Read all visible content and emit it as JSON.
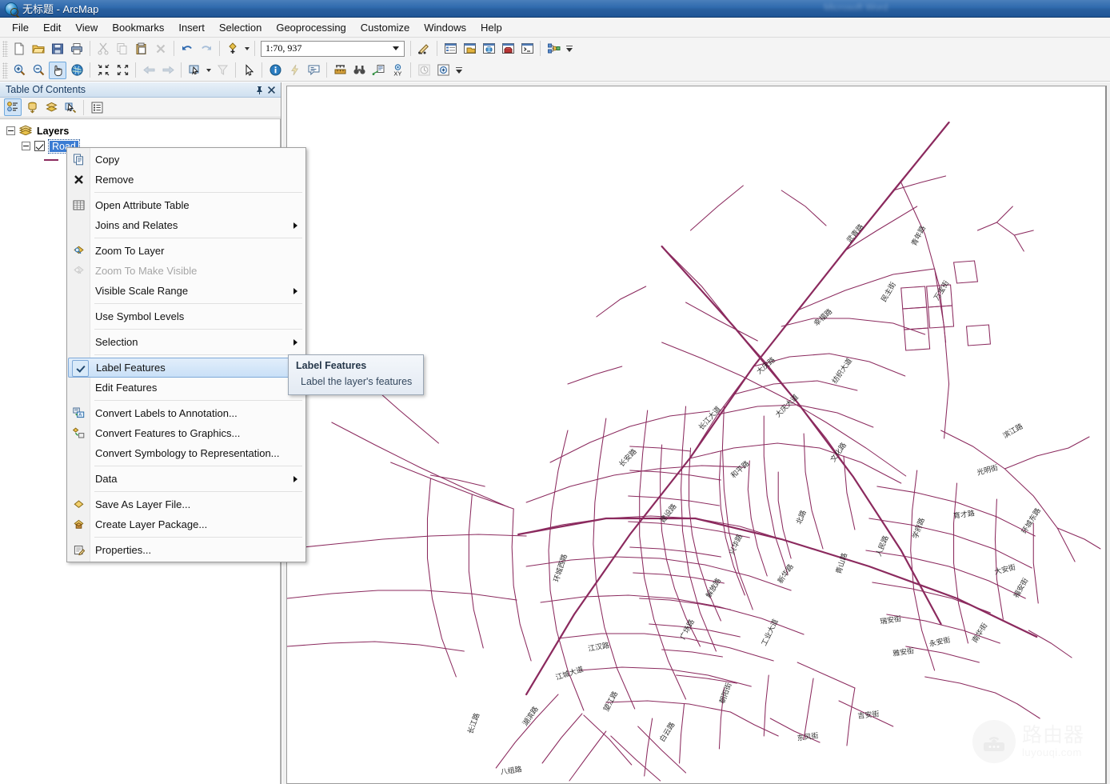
{
  "window": {
    "title": "无标题 - ArcMap",
    "ghost_title": "Microsoft Word"
  },
  "menubar": {
    "items": [
      {
        "label": "File"
      },
      {
        "label": "Edit"
      },
      {
        "label": "View"
      },
      {
        "label": "Bookmarks"
      },
      {
        "label": "Insert"
      },
      {
        "label": "Selection"
      },
      {
        "label": "Geoprocessing"
      },
      {
        "label": "Customize"
      },
      {
        "label": "Windows"
      },
      {
        "label": "Help"
      }
    ]
  },
  "toolbar_standard": {
    "scale_value": "1:70, 937",
    "buttons": [
      {
        "name": "new-map",
        "title": "New"
      },
      {
        "name": "open-map",
        "title": "Open"
      },
      {
        "name": "save-map",
        "title": "Save"
      },
      {
        "name": "print-map",
        "title": "Print"
      },
      {
        "name": "cut",
        "title": "Cut"
      },
      {
        "name": "copy",
        "title": "Copy"
      },
      {
        "name": "paste",
        "title": "Paste"
      },
      {
        "name": "delete",
        "title": "Delete"
      },
      {
        "name": "undo",
        "title": "Undo"
      },
      {
        "name": "redo",
        "title": "Redo"
      },
      {
        "name": "add-data",
        "title": "Add Data"
      },
      {
        "name": "editor-toolbar",
        "title": "Editor Toolbar"
      },
      {
        "name": "table-of-contents",
        "title": "Table Of Contents"
      },
      {
        "name": "catalog-window",
        "title": "Catalog"
      },
      {
        "name": "search-window",
        "title": "Search"
      },
      {
        "name": "arctoolbox-window",
        "title": "ArcToolbox"
      },
      {
        "name": "python-window",
        "title": "Python"
      },
      {
        "name": "model-builder",
        "title": "ModelBuilder"
      }
    ]
  },
  "toolbar_tools": {
    "buttons": [
      {
        "name": "zoom-in",
        "title": "Zoom In"
      },
      {
        "name": "zoom-out",
        "title": "Zoom Out"
      },
      {
        "name": "pan",
        "title": "Pan",
        "active": true
      },
      {
        "name": "full-extent",
        "title": "Full Extent"
      },
      {
        "name": "fixed-zoom-in",
        "title": "Fixed Zoom In"
      },
      {
        "name": "fixed-zoom-out",
        "title": "Fixed Zoom Out"
      },
      {
        "name": "go-back-extent",
        "title": "Go Back To Previous Extent"
      },
      {
        "name": "go-next-extent",
        "title": "Go To Next Extent"
      },
      {
        "name": "select-features",
        "title": "Select Features"
      },
      {
        "name": "clear-selection",
        "title": "Clear Selected Features"
      },
      {
        "name": "select-elements",
        "title": "Select Elements"
      },
      {
        "name": "identify",
        "title": "Identify"
      },
      {
        "name": "hyperlink",
        "title": "Hyperlink"
      },
      {
        "name": "html-popup",
        "title": "HTML Popup"
      },
      {
        "name": "measure",
        "title": "Measure"
      },
      {
        "name": "find",
        "title": "Find"
      },
      {
        "name": "find-route",
        "title": "Find Route"
      },
      {
        "name": "go-to-xy",
        "title": "Go To XY"
      },
      {
        "name": "time-slider",
        "title": "Time Slider"
      },
      {
        "name": "create-viewer-window",
        "title": "Create Viewer Window"
      }
    ]
  },
  "toc": {
    "title": "Table Of Contents",
    "pin_icon": "pin-icon",
    "close_icon": "close-icon",
    "toolbar_buttons": [
      {
        "name": "list-by-drawing-order",
        "active": true
      },
      {
        "name": "list-by-source",
        "active": false
      },
      {
        "name": "list-by-visibility",
        "active": false
      },
      {
        "name": "list-by-selection",
        "active": false
      },
      {
        "name": "options",
        "active": false
      }
    ],
    "tree": {
      "root_label": "Layers",
      "layer_label": "Road",
      "layer_checked": true,
      "layer_selected": true,
      "symbol_color": "#8b2a5e"
    }
  },
  "context_menu": {
    "items": [
      {
        "label": "Copy",
        "icon": "copy-icon",
        "type": "item"
      },
      {
        "label": "Remove",
        "icon": "remove-x-icon",
        "type": "item"
      },
      {
        "type": "separator"
      },
      {
        "label": "Open Attribute Table",
        "icon": "table-icon",
        "type": "item"
      },
      {
        "label": "Joins and Relates",
        "icon": "",
        "type": "submenu"
      },
      {
        "type": "separator"
      },
      {
        "label": "Zoom To Layer",
        "icon": "zoom-to-layer-icon",
        "type": "item"
      },
      {
        "label": "Zoom To Make Visible",
        "icon": "zoom-visible-icon",
        "type": "item",
        "disabled": true
      },
      {
        "label": "Visible Scale Range",
        "icon": "",
        "type": "submenu"
      },
      {
        "type": "separator"
      },
      {
        "label": "Use Symbol Levels",
        "icon": "",
        "type": "item"
      },
      {
        "type": "separator"
      },
      {
        "label": "Selection",
        "icon": "",
        "type": "submenu"
      },
      {
        "type": "separator"
      },
      {
        "label": "Label Features",
        "icon": "check-icon",
        "type": "item",
        "checked": true,
        "highlighted": true
      },
      {
        "label": "Edit Features",
        "icon": "",
        "type": "item"
      },
      {
        "type": "separator"
      },
      {
        "label": "Convert Labels to Annotation...",
        "icon": "labels-to-annotation-icon",
        "type": "item"
      },
      {
        "label": "Convert Features to Graphics...",
        "icon": "features-to-graphics-icon",
        "type": "item"
      },
      {
        "label": "Convert Symbology to Representation...",
        "icon": "",
        "type": "item"
      },
      {
        "type": "separator"
      },
      {
        "label": "Data",
        "icon": "",
        "type": "submenu"
      },
      {
        "type": "separator"
      },
      {
        "label": "Save As Layer File...",
        "icon": "layer-file-icon",
        "type": "item"
      },
      {
        "label": "Create Layer Package...",
        "icon": "layer-package-icon",
        "type": "item"
      },
      {
        "type": "separator"
      },
      {
        "label": "Properties...",
        "icon": "properties-icon",
        "type": "item"
      }
    ]
  },
  "tooltip": {
    "title": "Label Features",
    "body": "Label the layer's features"
  },
  "map": {
    "background": "#ffffff",
    "road_color": "#8b2a5e",
    "label_color": "#1a1a1a",
    "watermark": {
      "cn": "路由器",
      "en": "luyouqi.com",
      "icon": "router-icon"
    },
    "labels": [
      "武青路",
      "青年路",
      "万宝街",
      "民主街",
      "幸福路",
      "大庆路",
      "长江大道",
      "大庆大道",
      "纺织大道",
      "和平路",
      "建设路",
      "学府路",
      "育才路",
      "人民路",
      "解放路",
      "新华路",
      "江汉路",
      "江城大道",
      "光明街",
      "文化路",
      "永安街",
      "瑞安街",
      "雅安街",
      "吉安街",
      "大安街",
      "福安街",
      "青山路",
      "白云路",
      "朝阳街",
      "望江路",
      "湖滨路",
      "八组路",
      "长江路",
      "环城东路",
      "环城西路",
      "工业大道"
    ]
  }
}
